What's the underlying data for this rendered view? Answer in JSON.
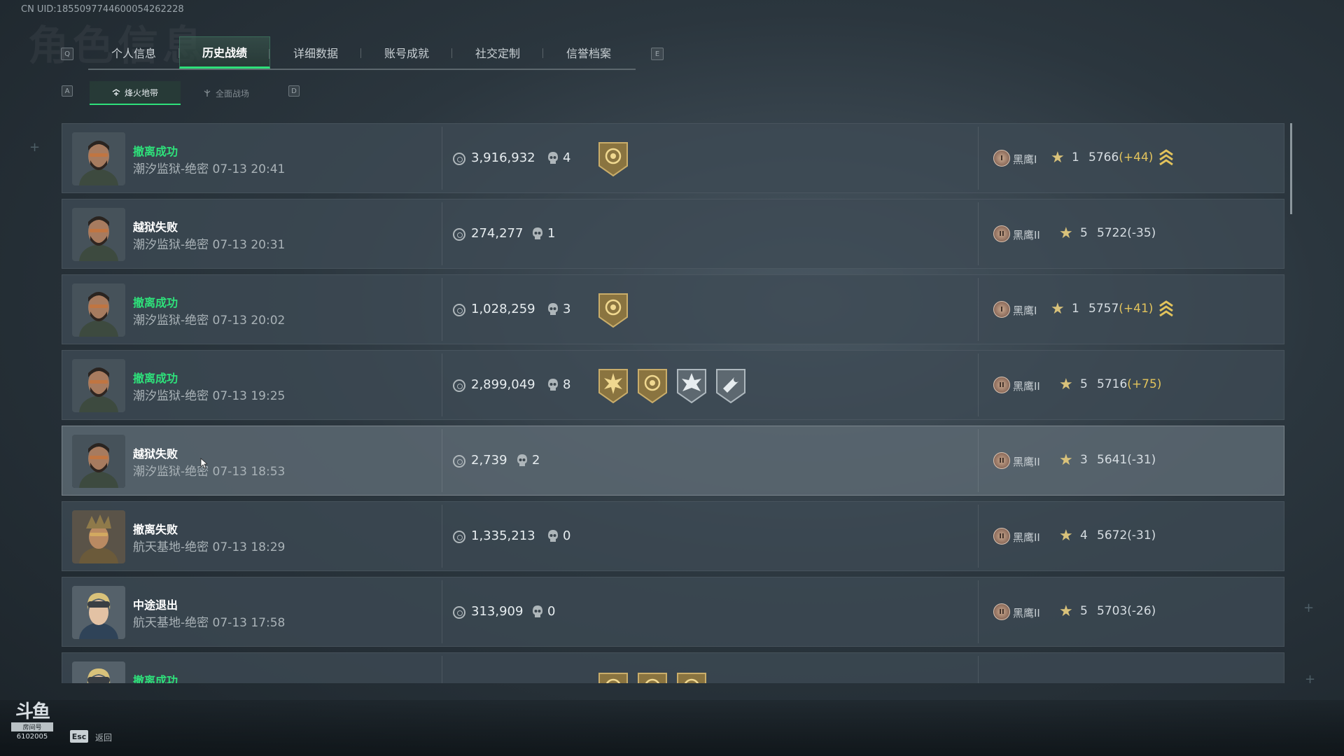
{
  "uid_label": "CN UID:1855097744600054262228",
  "bg_ghost_title": "角色信息",
  "key_hints": {
    "prev_tab": "Q",
    "next_tab": "E",
    "prev_subtab": "A",
    "next_subtab": "D"
  },
  "tabs": [
    {
      "label": "个人信息",
      "active": false
    },
    {
      "label": "历史战绩",
      "active": true
    },
    {
      "label": "详细数据",
      "active": false
    },
    {
      "label": "账号成就",
      "active": false
    },
    {
      "label": "社交定制",
      "active": false
    },
    {
      "label": "信誉档案",
      "active": false
    }
  ],
  "subtabs": [
    {
      "label": "烽火地带",
      "icon": "beacon-icon",
      "active": true
    },
    {
      "label": "全面战场",
      "icon": "battlefield-icon",
      "active": false
    }
  ],
  "records": [
    {
      "status": "撤离成功",
      "success": true,
      "map": "潮汐监狱-绝密",
      "time": "07-13 20:41",
      "money": "3,916,932",
      "kills": "4",
      "medals": [
        "extraction-medal-icon"
      ],
      "rank": "黑鹰I",
      "rank_numeral": "I",
      "stars": "1",
      "score": "5766",
      "delta": "(+44)",
      "delta_up": true,
      "promo": true
    },
    {
      "status": "越狱失败",
      "success": false,
      "map": "潮汐监狱-绝密",
      "time": "07-13 20:31",
      "money": "274,277",
      "kills": "1",
      "medals": [],
      "rank": "黑鹰II",
      "rank_numeral": "II",
      "stars": "5",
      "score": "5722",
      "delta": "(-35)",
      "delta_up": false,
      "promo": false
    },
    {
      "status": "撤离成功",
      "success": true,
      "map": "潮汐监狱-绝密",
      "time": "07-13 20:02",
      "money": "1,028,259",
      "kills": "3",
      "medals": [
        "extraction-medal-icon"
      ],
      "rank": "黑鹰I",
      "rank_numeral": "I",
      "stars": "1",
      "score": "5757",
      "delta": "(+41)",
      "delta_up": true,
      "promo": true
    },
    {
      "status": "撤离成功",
      "success": true,
      "map": "潮汐监狱-绝密",
      "time": "07-13 19:25",
      "money": "2,899,049",
      "kills": "8",
      "medals": [
        "sun-medal-icon",
        "extraction-medal-icon",
        "star-burst-medal-icon",
        "wrench-medal-icon"
      ],
      "rank": "黑鹰II",
      "rank_numeral": "II",
      "stars": "5",
      "score": "5716",
      "delta": "(+75)",
      "delta_up": true,
      "promo": false
    },
    {
      "status": "越狱失败",
      "success": false,
      "map": "潮汐监狱-绝密",
      "time": "07-13 18:53",
      "money": "2,739",
      "kills": "2",
      "medals": [],
      "rank": "黑鹰II",
      "rank_numeral": "II",
      "stars": "3",
      "score": "5641",
      "delta": "(-31)",
      "delta_up": false,
      "promo": false,
      "hover": true
    },
    {
      "status": "撤离失败",
      "success": false,
      "map": "航天基地-绝密",
      "time": "07-13 18:29",
      "money": "1,335,213",
      "kills": "0",
      "medals": [],
      "rank": "黑鹰II",
      "rank_numeral": "II",
      "stars": "4",
      "score": "5672",
      "delta": "(-31)",
      "delta_up": false,
      "promo": false,
      "avatar_alt": true
    },
    {
      "status": "中途退出",
      "success": false,
      "map": "航天基地-绝密",
      "time": "07-13 17:58",
      "money": "313,909",
      "kills": "0",
      "medals": [],
      "rank": "黑鹰II",
      "rank_numeral": "II",
      "stars": "5",
      "score": "5703",
      "delta": "(-26)",
      "delta_up": false,
      "promo": false,
      "avatar_female": true
    },
    {
      "status": "撤离成功",
      "success": true,
      "map": "",
      "time": "",
      "money": "",
      "kills": "",
      "medals": [
        "extraction-medal-icon",
        "extraction-medal-icon",
        "extraction-medal-icon"
      ],
      "rank": "",
      "rank_numeral": "",
      "stars": "",
      "score": "",
      "delta": "",
      "delta_up": false,
      "promo": false,
      "avatar_female": true,
      "partial": true
    }
  ],
  "footer": {
    "esc_key": "Esc",
    "esc_label": "返回",
    "logo_main": "斗鱼",
    "logo_sub": "房间号",
    "logo_num": "6102005"
  },
  "colors": {
    "accent_green": "#2ee07a",
    "gold": "#e2c35c",
    "star": "#d9c27a"
  }
}
